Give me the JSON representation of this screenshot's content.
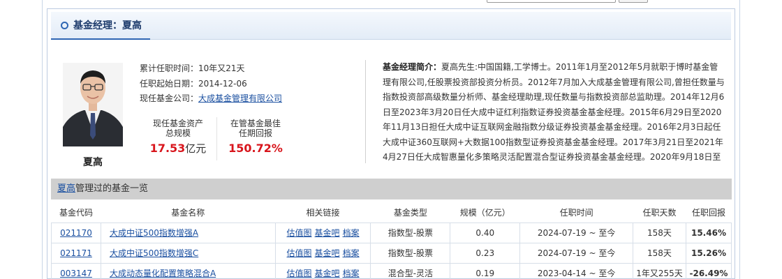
{
  "panel": {
    "title": "基金经理：夏高"
  },
  "manager": {
    "name": "夏高",
    "tenure_label": "累计任职时间：",
    "tenure": "10年又21天",
    "start_label": "任职起始日期：",
    "start_date": "2014-12-06",
    "company_label": "现任基金公司：",
    "company": "大成基金管理有限公司"
  },
  "stats": {
    "assets_label_1": "现任基金资产",
    "assets_label_2": "总规模",
    "assets_value": "17.53",
    "assets_unit": "亿元",
    "best_label_1": "在管基金最佳",
    "best_label_2": "任期回报",
    "best_value": "150.72%"
  },
  "bio": {
    "label": "基金经理简介：",
    "text": "夏高先生:中国国籍,工学博士。2011年1月至2012年5月就职于博时基金管理有限公司,任股票投资部投资分析员。2012年7月加入大成基金管理有限公司,曾担任数量与指数投资部高级数量分析师、基金经理助理,现任数量与指数投资部总监助理。2014年12月6日至2023年3月20日任大成中证红利指数证券投资基金基金经理。2015年6月29日至2020年11月13日担任大成中证互联网金融指数分级证券投资基金基金经理。2016年2月3日起任大成中证360互联网+大数据100指数型证券投资基金基金经理。2017年3月21日至2021年4月27日任大成智惠量化多策略灵活配置混合型证券投资基金基金经理。2020年9月18日至2022年10月"
  },
  "funds": {
    "header_name": "夏高",
    "header_suffix": "管理过的基金一览",
    "columns": [
      "基金代码",
      "基金名称",
      "相关链接",
      "基金类型",
      "规模（亿元）",
      "任职时间",
      "任职天数",
      "任职回报"
    ],
    "links": [
      "估值图",
      "基金吧",
      "档案"
    ],
    "rows": [
      {
        "code": "021170",
        "name": "大成中证500指数增强A",
        "type": "指数型-股票",
        "size": "0.40",
        "period": "2024-07-19 ~ 至今",
        "days": "158天",
        "return": "15.46%"
      },
      {
        "code": "021171",
        "name": "大成中证500指数增强C",
        "type": "指数型-股票",
        "size": "0.23",
        "period": "2024-07-19 ~ 至今",
        "days": "158天",
        "return": "15.26%"
      },
      {
        "code": "003147",
        "name": "大成动态量化配置策略混合A",
        "type": "混合型-灵活",
        "size": "0.19",
        "period": "2023-04-14 ~ 至今",
        "days": "1年又255天",
        "return": "-26.49%"
      }
    ]
  }
}
